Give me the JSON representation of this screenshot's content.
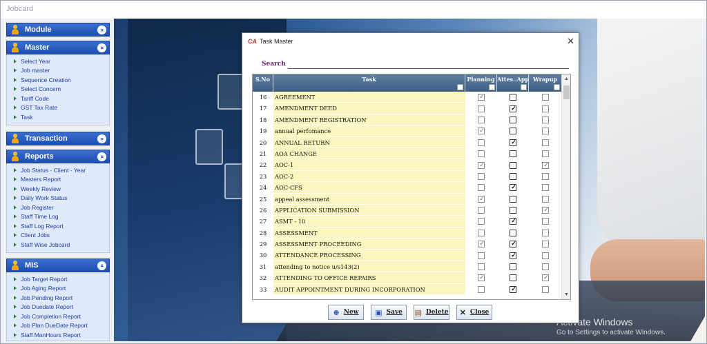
{
  "app": {
    "title": "Jobcard"
  },
  "sidebar": {
    "sections": [
      {
        "title": "Module",
        "items": []
      },
      {
        "title": "Master",
        "items": [
          "Select Year",
          "Job master",
          "Sequence Creation",
          "Select Concern",
          "Tariff Code",
          "GST Tax Rate",
          "Task"
        ]
      },
      {
        "title": "Transaction",
        "items": []
      },
      {
        "title": "Reports",
        "items": [
          "Job Status - Client - Year",
          "Masters Report",
          "Weekly Review",
          "Daily Work Status",
          "Job Register",
          "Staff Time Log",
          "Staff Log Report",
          "Client Jobs",
          "Staff Wise Jobcard"
        ]
      },
      {
        "title": "MIS",
        "items": [
          "Job Target Report",
          "Job Aging Report",
          "Job Pending Report",
          "Job Duedate Report",
          "Job Completion Report",
          "Job Plan DueDate Report",
          "Staff ManHours Report"
        ]
      }
    ]
  },
  "dialog": {
    "title": "Task Master",
    "logo": "CA",
    "close": "✕",
    "search_label": "Search",
    "search_value": "",
    "columns": {
      "sno": "S.No",
      "task": "Task",
      "planning": "Planning",
      "attes": "Attes..Appl",
      "wrapup": "Wrapup"
    },
    "rows": [
      {
        "sno": "16",
        "task": "AGREEMENT",
        "planning": true,
        "attes": false,
        "wrapup": false
      },
      {
        "sno": "17",
        "task": "AMENDMENT DEED",
        "planning": false,
        "attes": true,
        "wrapup": false
      },
      {
        "sno": "18",
        "task": "AMENDMENT REGISTRATION",
        "planning": false,
        "attes": false,
        "wrapup": false
      },
      {
        "sno": "19",
        "task": "annual perfomance",
        "planning": true,
        "attes": false,
        "wrapup": false
      },
      {
        "sno": "20",
        "task": "ANNUAL RETURN",
        "planning": false,
        "attes": true,
        "wrapup": false
      },
      {
        "sno": "21",
        "task": "AOA CHANGE",
        "planning": false,
        "attes": false,
        "wrapup": false
      },
      {
        "sno": "22",
        "task": "AOC-1",
        "planning": true,
        "attes": false,
        "wrapup": true
      },
      {
        "sno": "23",
        "task": "AOC-2",
        "planning": false,
        "attes": false,
        "wrapup": false
      },
      {
        "sno": "24",
        "task": "AOC-CFS",
        "planning": false,
        "attes": true,
        "wrapup": false
      },
      {
        "sno": "25",
        "task": "appeal assessment",
        "planning": true,
        "attes": false,
        "wrapup": false
      },
      {
        "sno": "26",
        "task": "APPLICATION SUBMISSION",
        "planning": false,
        "attes": false,
        "wrapup": true
      },
      {
        "sno": "27",
        "task": "ASMT - 10",
        "planning": false,
        "attes": true,
        "wrapup": false
      },
      {
        "sno": "28",
        "task": "ASSESSMENT",
        "planning": false,
        "attes": false,
        "wrapup": false
      },
      {
        "sno": "29",
        "task": "ASSESSMENT PROCEEDING",
        "planning": true,
        "attes": true,
        "wrapup": false
      },
      {
        "sno": "30",
        "task": "ATTENDANCE PROCESSING",
        "planning": false,
        "attes": true,
        "wrapup": false
      },
      {
        "sno": "31",
        "task": "attending to notice u/s143(2)",
        "planning": false,
        "attes": false,
        "wrapup": false
      },
      {
        "sno": "32",
        "task": "ATTENDING TO OFFICE REPAIRS",
        "planning": true,
        "attes": false,
        "wrapup": true
      },
      {
        "sno": "33",
        "task": "AUDIT APPOINTMENT DURING INCORPORATION",
        "planning": false,
        "attes": true,
        "wrapup": false
      }
    ],
    "buttons": {
      "new": "New",
      "save": "Save",
      "delete": "Delete",
      "close": "Close"
    }
  },
  "watermark": {
    "line1": "Activate Windows",
    "line2": "Go to Settings to activate Windows."
  },
  "colors": {
    "sidebar_header": "#1d4fb3",
    "grid_header": "#3d5f82",
    "task_cell": "#fbf6c0",
    "search_label": "#6a1b6a"
  }
}
